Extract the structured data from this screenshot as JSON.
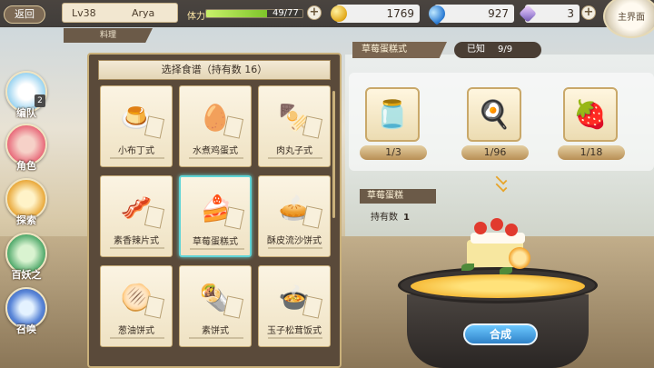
{
  "topbar": {
    "back_label": "返回",
    "level": "Lv38",
    "player_name": "Arya",
    "stamina_label": "体力",
    "stamina_value": "49/77",
    "stamina_fraction": 0.636,
    "gold": "1769",
    "water": "927",
    "gems": "3",
    "main_menu_label": "主界面"
  },
  "tab_label": "料理",
  "left_nav": {
    "items": [
      {
        "label": "编队",
        "icon": "bunny-icon",
        "badge": "2"
      },
      {
        "label": "角色",
        "icon": "character-icon"
      },
      {
        "label": "探索",
        "icon": "tent-icon"
      },
      {
        "label": "百妖之",
        "icon": "forest-icon"
      },
      {
        "label": "召唤",
        "icon": "swirl-icon"
      }
    ]
  },
  "recipe_panel": {
    "title": "选择食谱（持有数 16）",
    "recipes": [
      {
        "name": "小布丁式",
        "icon": "🍮"
      },
      {
        "name": "水煮鸡蛋式",
        "icon": "🥚"
      },
      {
        "name": "肉丸子式",
        "icon": "🍢"
      },
      {
        "name": "素香辣片式",
        "icon": "🥓"
      },
      {
        "name": "草莓蛋糕式",
        "icon": "🍰",
        "selected": true
      },
      {
        "name": "酥皮流沙饼式",
        "icon": "🥧"
      },
      {
        "name": "葱油饼式",
        "icon": "🫓"
      },
      {
        "name": "素饼式",
        "icon": "🌯"
      },
      {
        "name": "玉子松茸饭式",
        "icon": "🍲"
      }
    ]
  },
  "detail": {
    "recipe_name": "草莓蛋糕式",
    "known_label": "已知",
    "known_value": "9/9",
    "ingredients": [
      {
        "icon": "🫙",
        "name": "milk-jar-icon",
        "count": "1/3"
      },
      {
        "icon": "🍳",
        "name": "fried-egg-icon",
        "count": "1/96"
      },
      {
        "icon": "🍓",
        "name": "strawberry-icon",
        "count": "1/18"
      }
    ],
    "result_name": "草莓蛋糕",
    "owned_label": "持有数",
    "owned_value": "1",
    "synth_label": "合成"
  },
  "colors": {
    "accent_cyan": "#5fd4d6",
    "synth_blue": "#2f82c8",
    "panel_brown": "#5a4a3a"
  }
}
